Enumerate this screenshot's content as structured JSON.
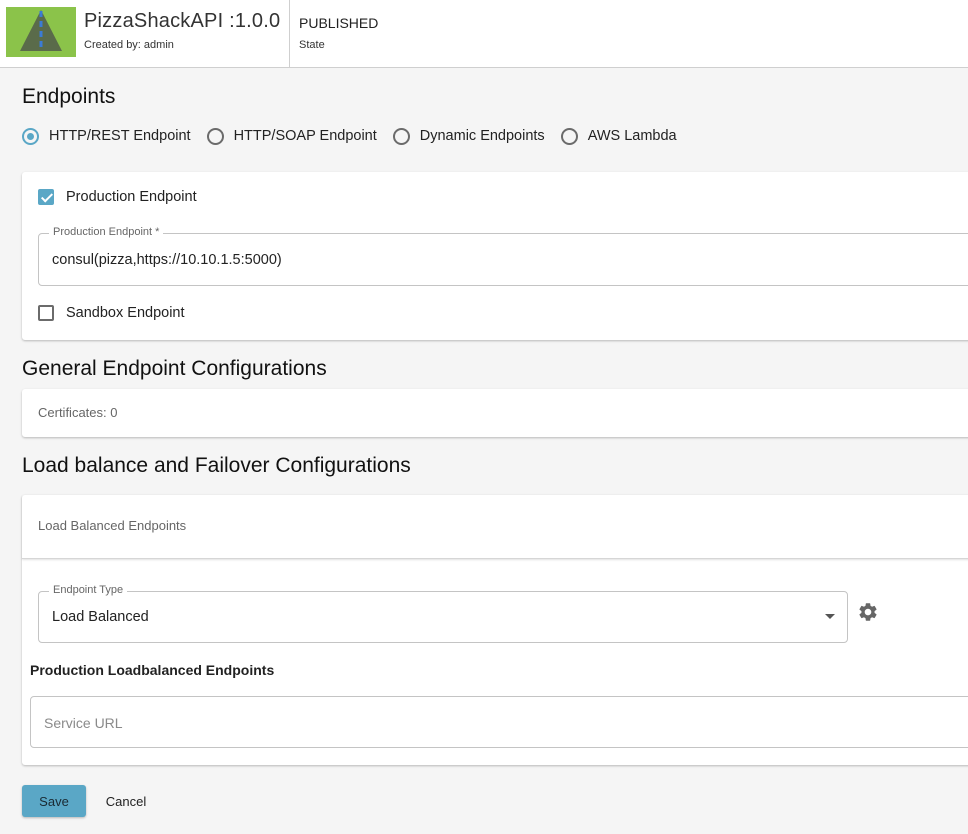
{
  "header": {
    "api_title": "PizzaShackAPI :1.0.0",
    "created_by": "Created by: admin",
    "state_value": "PUBLISHED",
    "state_label": "State"
  },
  "endpoints": {
    "heading": "Endpoints",
    "types": [
      {
        "label": "HTTP/REST Endpoint",
        "selected": true
      },
      {
        "label": "HTTP/SOAP Endpoint",
        "selected": false
      },
      {
        "label": "Dynamic Endpoints",
        "selected": false
      },
      {
        "label": "AWS Lambda",
        "selected": false
      }
    ],
    "production_checkbox_label": "Production Endpoint",
    "production_field_label": "Production Endpoint *",
    "production_field_value": "consul(pizza,https://10.10.1.5:5000)",
    "sandbox_checkbox_label": "Sandbox Endpoint"
  },
  "general": {
    "heading": "General Endpoint Configurations",
    "certificates": "Certificates: 0"
  },
  "loadbalance": {
    "heading": "Load balance and Failover Configurations",
    "panel_title": "Load Balanced Endpoints",
    "endpoint_type_label": "Endpoint Type",
    "endpoint_type_value": "Load Balanced",
    "production_heading": "Production Loadbalanced Endpoints",
    "service_url_placeholder": "Service URL"
  },
  "actions": {
    "save": "Save",
    "cancel": "Cancel"
  },
  "colors": {
    "accent": "#5aa7c6",
    "thumbnail": "#8bc34a"
  },
  "icons": [
    "road-thumbnail-icon",
    "dropdown-arrow-icon",
    "gear-icon"
  ]
}
